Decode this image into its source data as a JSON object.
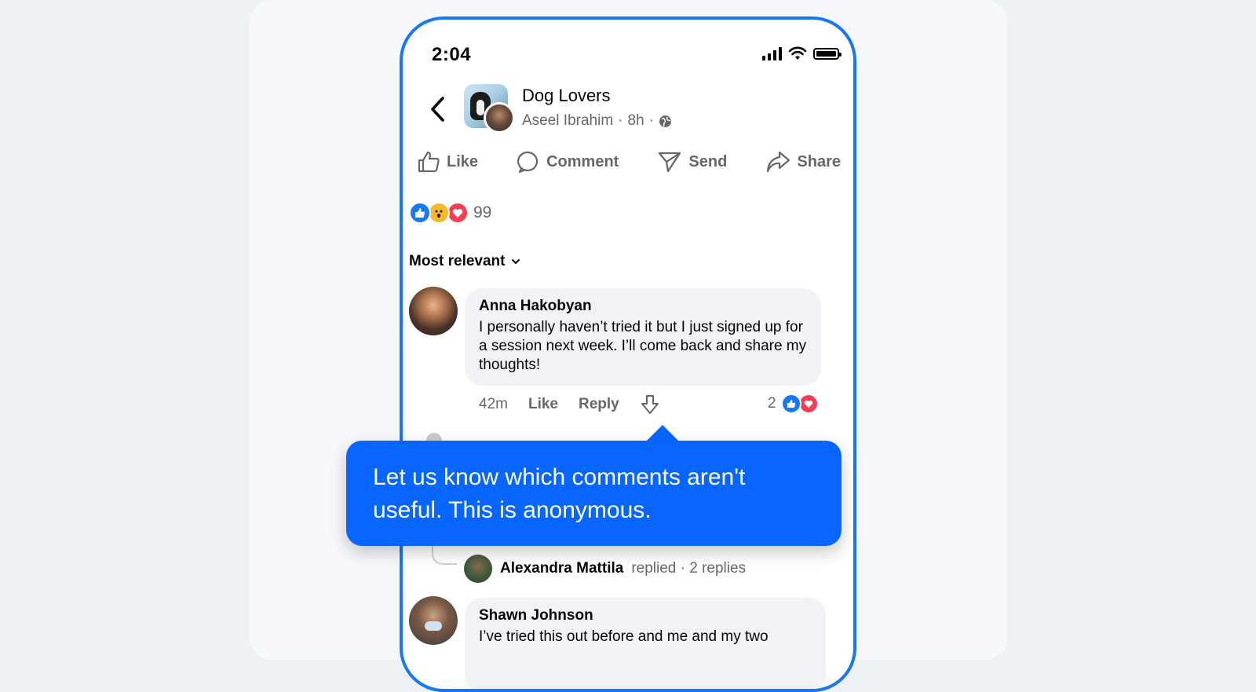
{
  "status_bar": {
    "time": "2:04"
  },
  "post": {
    "group_name": "Dog Lovers",
    "author": "Aseel Ibrahim",
    "separator": "·",
    "time": "8h"
  },
  "actions": {
    "like": "Like",
    "comment": "Comment",
    "send": "Send",
    "share": "Share"
  },
  "reactions": {
    "count": "99"
  },
  "sort": {
    "label": "Most relevant"
  },
  "comments": [
    {
      "name": "Anna Hakobyan",
      "text": "I personally haven’t tried it but I just signed up for a session next week. I’ll come back and share my thoughts!",
      "time": "42m",
      "like_label": "Like",
      "reply_label": "Reply",
      "reaction_count": "2"
    },
    {
      "name": "Shawn Johnson",
      "text": "I’ve tried this out before and me and my two"
    }
  ],
  "reply_summary": {
    "name": "Alexandra Mattila",
    "rest": "replied · 2 replies"
  },
  "tooltip": {
    "text": "Let us know which comments aren't useful. This is anonymous."
  },
  "colors": {
    "accent": "#0866ff",
    "phone_border": "#1877f2",
    "like": "#1877f2",
    "love": "#f33e58",
    "wow": "#f7b928"
  }
}
